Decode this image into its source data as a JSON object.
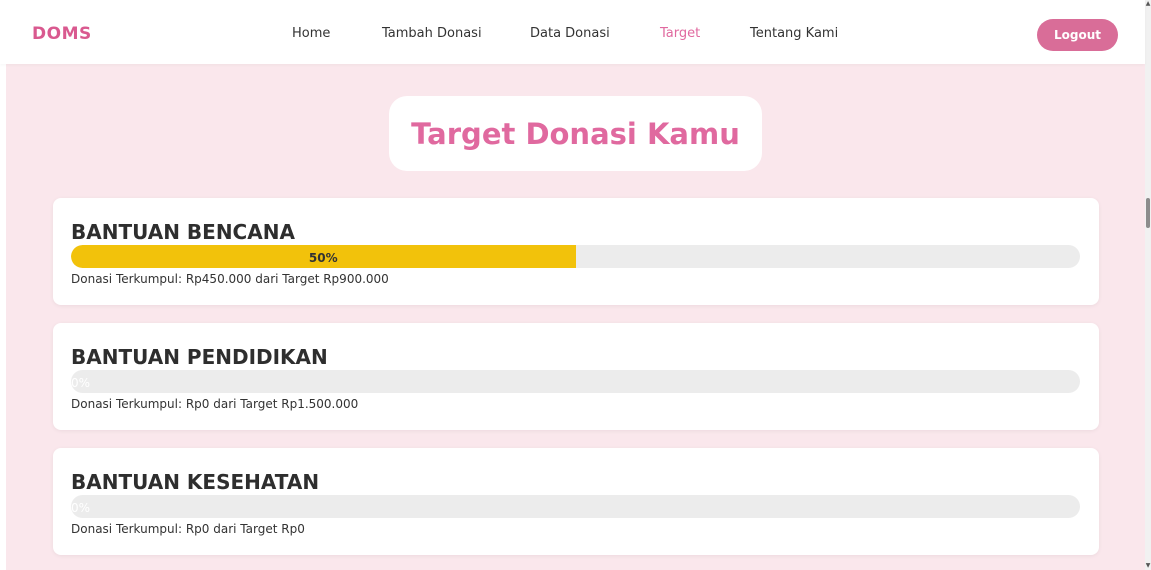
{
  "nav": {
    "brand": "DOMS",
    "links": [
      {
        "label": "Home",
        "active": false
      },
      {
        "label": "Tambah Donasi",
        "active": false
      },
      {
        "label": "Data Donasi",
        "active": false
      },
      {
        "label": "Target",
        "active": true
      },
      {
        "label": "Tentang Kami",
        "active": false
      }
    ],
    "logout_label": "Logout"
  },
  "page": {
    "title": "Target Donasi Kamu"
  },
  "targets": [
    {
      "name": "BANTUAN BENCANA",
      "progress_percent": 50,
      "progress_label": "50%",
      "info": "Donasi Terkumpul: Rp450.000 dari Target Rp900.000"
    },
    {
      "name": "BANTUAN PENDIDIKAN",
      "progress_percent": 0,
      "progress_label": "0%",
      "info": "Donasi Terkumpul: Rp0 dari Target Rp1.500.000"
    },
    {
      "name": "BANTUAN KESEHATAN",
      "progress_percent": 0,
      "progress_label": "0%",
      "info": "Donasi Terkumpul: Rp0 dari Target Rp0"
    }
  ],
  "colors": {
    "brand": "#d9598f",
    "accent": "#e0699f",
    "logout_bg": "#d96d98",
    "page_bg": "#fae7ec",
    "progress_fill": "#f2c20b",
    "progress_track": "#ececec"
  }
}
